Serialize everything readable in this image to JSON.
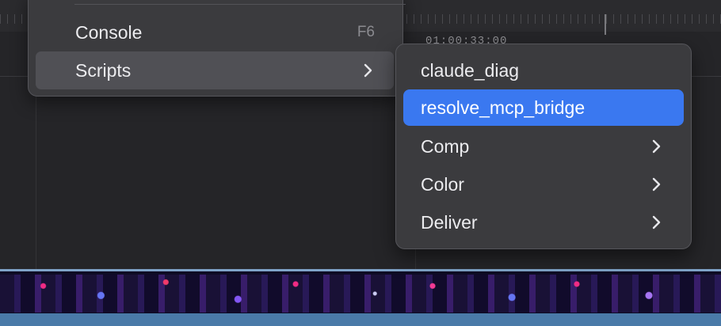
{
  "timeline": {
    "timecode": "01:00:33:00"
  },
  "main_menu": {
    "items": [
      {
        "label": "Console",
        "shortcut": "F6"
      },
      {
        "label": "Scripts",
        "has_submenu": true
      }
    ]
  },
  "scripts_submenu": {
    "items": [
      {
        "label": "claude_diag",
        "has_submenu": false
      },
      {
        "label": "resolve_mcp_bridge",
        "has_submenu": false,
        "highlighted": true
      },
      {
        "label": "Comp",
        "has_submenu": true
      },
      {
        "label": "Color",
        "has_submenu": true
      },
      {
        "label": "Deliver",
        "has_submenu": true
      }
    ]
  },
  "colors": {
    "menu_bg": "#3b3b3e",
    "highlight": "#3a78f0",
    "track_bottom": "#4a7aa8"
  },
  "icons": {
    "submenu_arrow": "chevron-right-icon"
  }
}
